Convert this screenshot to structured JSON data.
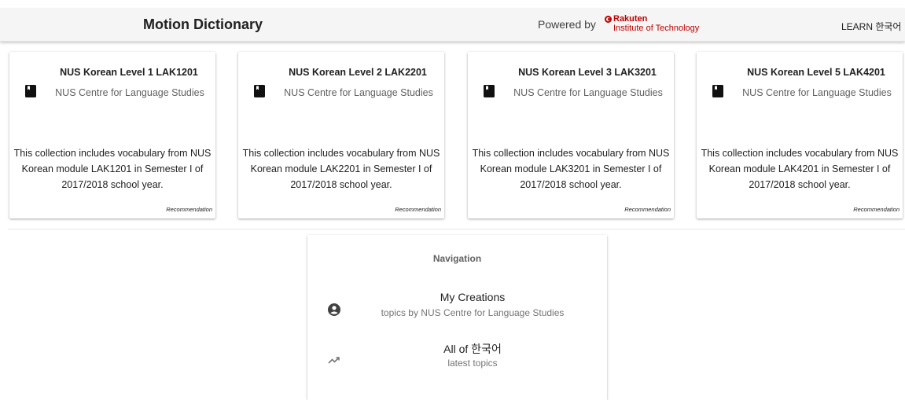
{
  "header": {
    "title": "Motion Dictionary",
    "powered_by": "Powered by",
    "rakuten_name": "Rakuten",
    "rakuten_sub": "Institute of Technology",
    "learn_link": "LEARN 한국어",
    "brand_color": "#bf0000"
  },
  "cards": [
    {
      "title": "NUS Korean Level 1 LAK1201",
      "org": "NUS Centre for Language Studies",
      "description": "This collection includes vocabulary from NUS Korean module LAK1201 in Semester I of 2017/2018 school year.",
      "tag": "Recommendation",
      "icon": "book-icon"
    },
    {
      "title": "NUS Korean Level 2 LAK2201",
      "org": "NUS Centre for Language Studies",
      "description": "This collection includes vocabulary from NUS Korean module LAK2201 in Semester I of 2017/2018 school year.",
      "tag": "Recommendation",
      "icon": "book-icon"
    },
    {
      "title": "NUS Korean Level 3 LAK3201",
      "org": "NUS Centre for Language Studies",
      "description": "This collection includes vocabulary from NUS Korean module LAK3201 in Semester I of 2017/2018 school year.",
      "tag": "Recommendation",
      "icon": "book-icon"
    },
    {
      "title": "NUS Korean Level 5 LAK4201",
      "org": "NUS Centre for Language Studies",
      "description": "This collection includes vocabulary from NUS Korean module LAK4201 in Semester I of 2017/2018 school year.",
      "tag": "Recommendation",
      "icon": "book-icon"
    }
  ],
  "navigation": {
    "title": "Navigation",
    "items": [
      {
        "label": "My Creations",
        "sub": "topics by NUS Centre for Language Studies",
        "icon": "account-circle-icon"
      },
      {
        "label": "All of 한국어",
        "sub": "latest topics",
        "icon": "trending-up-icon"
      }
    ]
  }
}
